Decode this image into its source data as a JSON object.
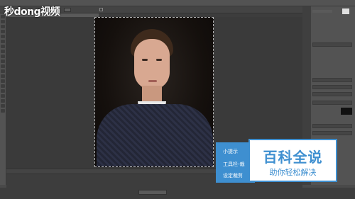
{
  "watermark": {
    "logo_text": "秒dong视频"
  },
  "tip": {
    "line1": "小提示",
    "line2": "工具栏-裁",
    "line3": "设定裁剪"
  },
  "badge": {
    "title": "百科全说",
    "subtitle": "助你轻松解决"
  },
  "colors": {
    "accent": "#3e8fd0",
    "panel": "#535353",
    "canvas": "#3a3a3a"
  }
}
